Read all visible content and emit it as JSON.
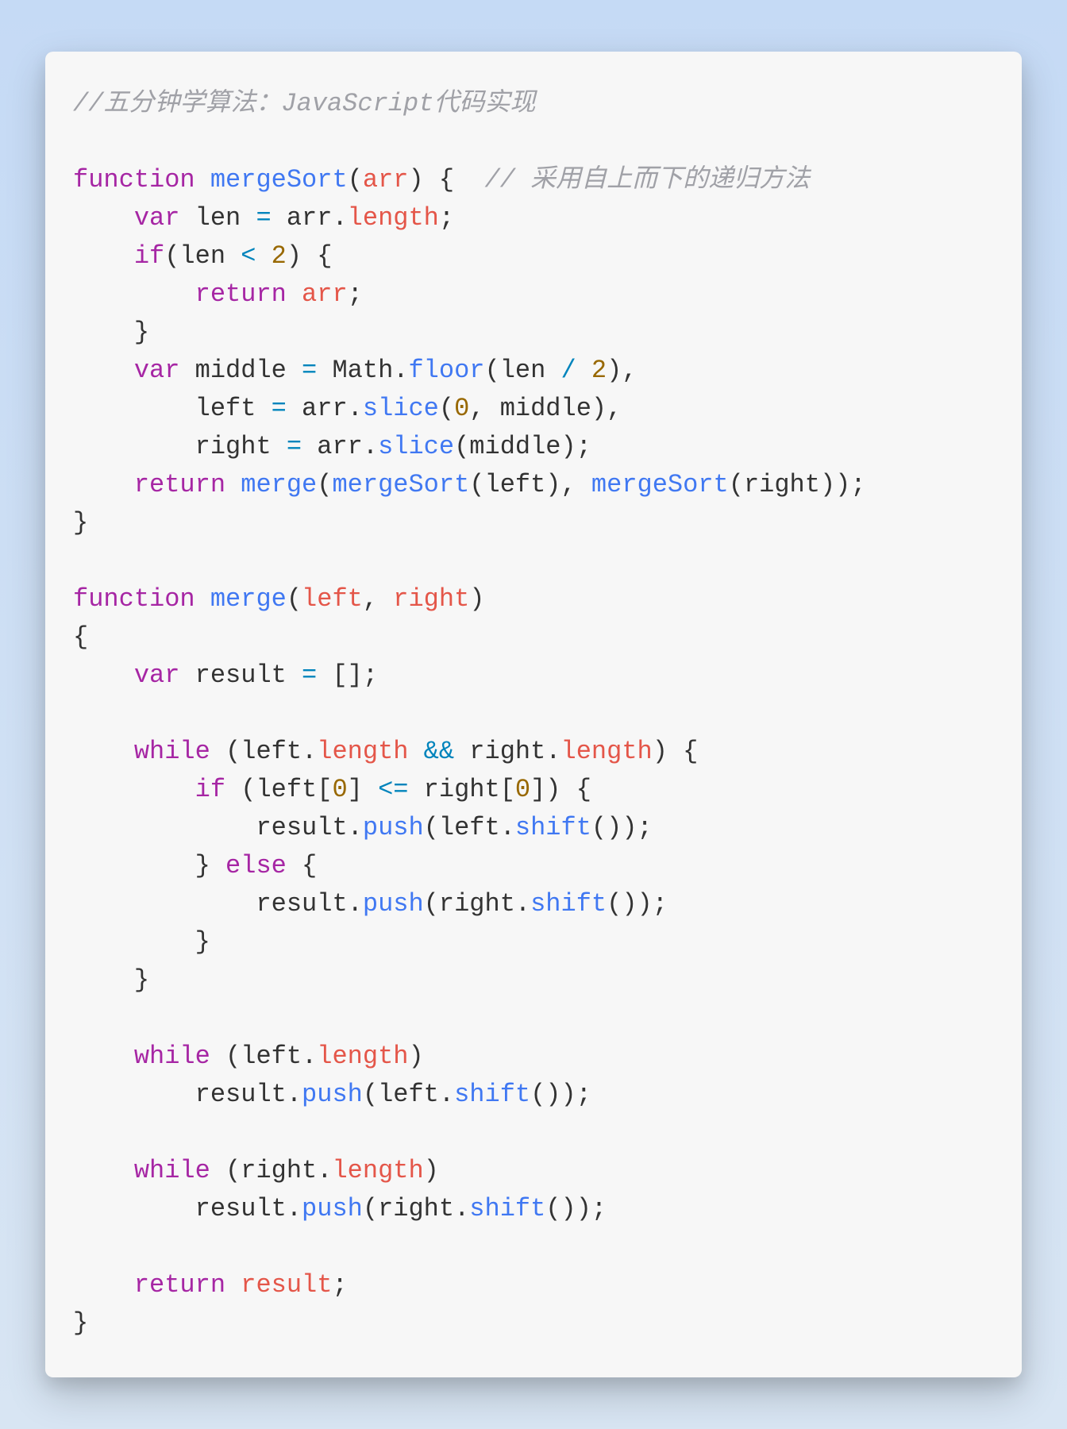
{
  "code": {
    "comment_header": "//五分钟学算法：JavaScript代码实现",
    "comment_inline_1": "// 采用自上而下的递归方法",
    "kw_function": "function",
    "kw_var": "var",
    "kw_if": "if",
    "kw_return": "return",
    "kw_while": "while",
    "kw_else": "else",
    "fn_mergeSort": "mergeSort",
    "fn_merge": "merge",
    "fn_floor": "floor",
    "fn_slice": "slice",
    "fn_push": "push",
    "fn_shift": "shift",
    "id_arr": "arr",
    "id_len": "len",
    "id_middle": "middle",
    "id_left": "left",
    "id_right": "right",
    "id_result": "result",
    "id_Math": "Math",
    "prop_length": "length",
    "num_2": "2",
    "num_0": "0",
    "op_eq": "=",
    "op_lt": "<",
    "op_div": "/",
    "op_and": "&&",
    "op_lte": "<=",
    "p_lparen": "(",
    "p_rparen": ")",
    "p_lbrace": "{",
    "p_rbrace": "}",
    "p_lbracket": "[",
    "p_rbracket": "]",
    "p_semi": ";",
    "p_comma": ",",
    "p_dot": "."
  }
}
